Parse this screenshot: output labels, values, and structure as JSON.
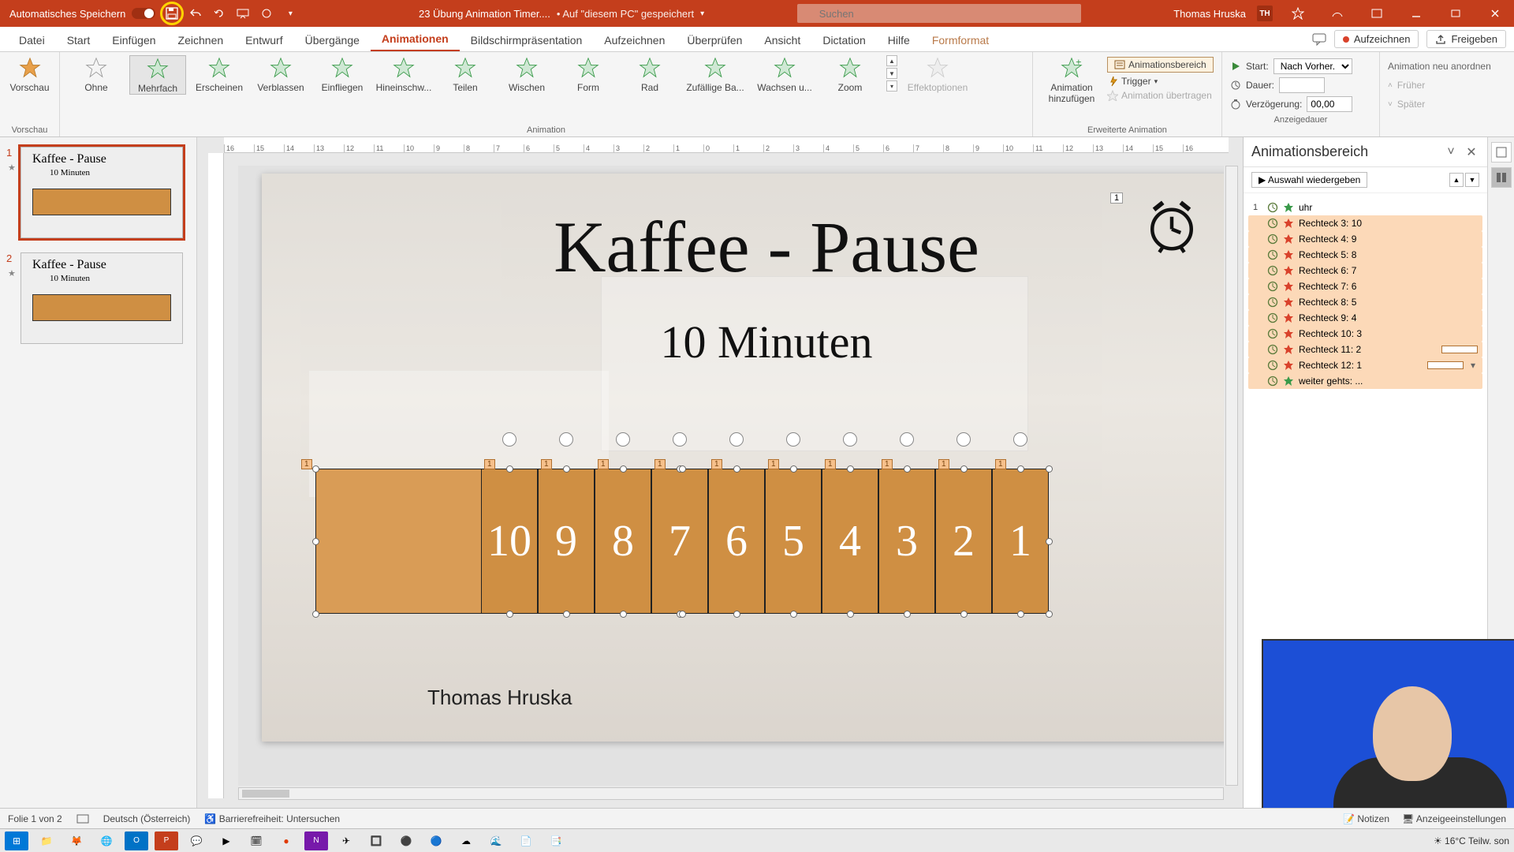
{
  "titlebar": {
    "autosave_label": "Automatisches Speichern",
    "doc_name": "23 Übung Animation Timer....",
    "saved_location": "• Auf \"diesem PC\" gespeichert",
    "search_placeholder": "Suchen",
    "user_name": "Thomas Hruska",
    "user_initials": "TH"
  },
  "tabs": {
    "datei": "Datei",
    "start": "Start",
    "einfuegen": "Einfügen",
    "zeichnen": "Zeichnen",
    "entwurf": "Entwurf",
    "uebergaenge": "Übergänge",
    "animationen": "Animationen",
    "bildschirm": "Bildschirmpräsentation",
    "aufzeichnen": "Aufzeichnen",
    "ueberpruefen": "Überprüfen",
    "ansicht": "Ansicht",
    "dictation": "Dictation",
    "hilfe": "Hilfe",
    "formformat": "Formformat",
    "btn_aufzeichnen": "Aufzeichnen",
    "btn_freigeben": "Freigeben"
  },
  "ribbon": {
    "vorschau": "Vorschau",
    "vorschau_grp": "Vorschau",
    "anim": {
      "ohne": "Ohne",
      "mehrfach": "Mehrfach",
      "erscheinen": "Erscheinen",
      "verblassen": "Verblassen",
      "einfliegen": "Einfliegen",
      "hineinschw": "Hineinschw...",
      "teilen": "Teilen",
      "wischen": "Wischen",
      "form": "Form",
      "rad": "Rad",
      "zufaellige": "Zufällige Ba...",
      "wachsen": "Wachsen u...",
      "zoom": "Zoom"
    },
    "effektoptionen": "Effektoptionen",
    "animation_grp": "Animation",
    "add_anim": "Animation hinzufügen",
    "pane_btn": "Animationsbereich",
    "trigger": "Trigger",
    "uebertragen": "Animation übertragen",
    "erweiterte_grp": "Erweiterte Animation",
    "start_lbl": "Start:",
    "start_val": "Nach Vorher...",
    "dauer_lbl": "Dauer:",
    "dauer_val": "",
    "verz_lbl": "Verzögerung:",
    "verz_val": "00,00",
    "reorder_lbl": "Animation neu anordnen",
    "frueher": "Früher",
    "spaeter": "Später",
    "anzeigedauer_grp": "Anzeigedauer"
  },
  "thumbs": {
    "t1_title": "Kaffee - Pause",
    "t1_sub": "10 Minuten",
    "t2_title": "Kaffee - Pause",
    "t2_sub": "10 Minuten"
  },
  "slide": {
    "title": "Kaffee - Pause",
    "subtitle": "10 Minuten",
    "author": "Thomas Hruska",
    "clock_tag": "1",
    "cells": [
      "10",
      "9",
      "8",
      "7",
      "6",
      "5",
      "4",
      "3",
      "2",
      "1"
    ],
    "atag": "1"
  },
  "anim_pane": {
    "title": "Animationsbereich",
    "play": "Auswahl wiedergeben",
    "index": "1",
    "items": [
      {
        "label": "uhr",
        "type": "entrance",
        "sel": false
      },
      {
        "label": "Rechteck 3: 10",
        "type": "exit",
        "sel": true
      },
      {
        "label": "Rechteck 4: 9",
        "type": "exit",
        "sel": true
      },
      {
        "label": "Rechteck 5: 8",
        "type": "exit",
        "sel": true
      },
      {
        "label": "Rechteck 6: 7",
        "type": "exit",
        "sel": true
      },
      {
        "label": "Rechteck 7: 6",
        "type": "exit",
        "sel": true
      },
      {
        "label": "Rechteck 8: 5",
        "type": "exit",
        "sel": true
      },
      {
        "label": "Rechteck 9: 4",
        "type": "exit",
        "sel": true
      },
      {
        "label": "Rechteck 10: 3",
        "type": "exit",
        "sel": true
      },
      {
        "label": "Rechteck 11: 2",
        "type": "exit",
        "sel": true,
        "bar": true
      },
      {
        "label": "Rechteck 12: 1",
        "type": "exit",
        "sel": true,
        "bar": true,
        "dd": true
      },
      {
        "label": "weiter gehts: ...",
        "type": "entrance",
        "sel": true
      }
    ]
  },
  "status": {
    "folie": "Folie 1 von 2",
    "lang": "Deutsch (Österreich)",
    "access": "Barrierefreiheit: Untersuchen",
    "notizen": "Notizen",
    "anzeige": "Anzeigeeinstellungen"
  },
  "tray": {
    "weather": "16°C  Teilw. son"
  }
}
